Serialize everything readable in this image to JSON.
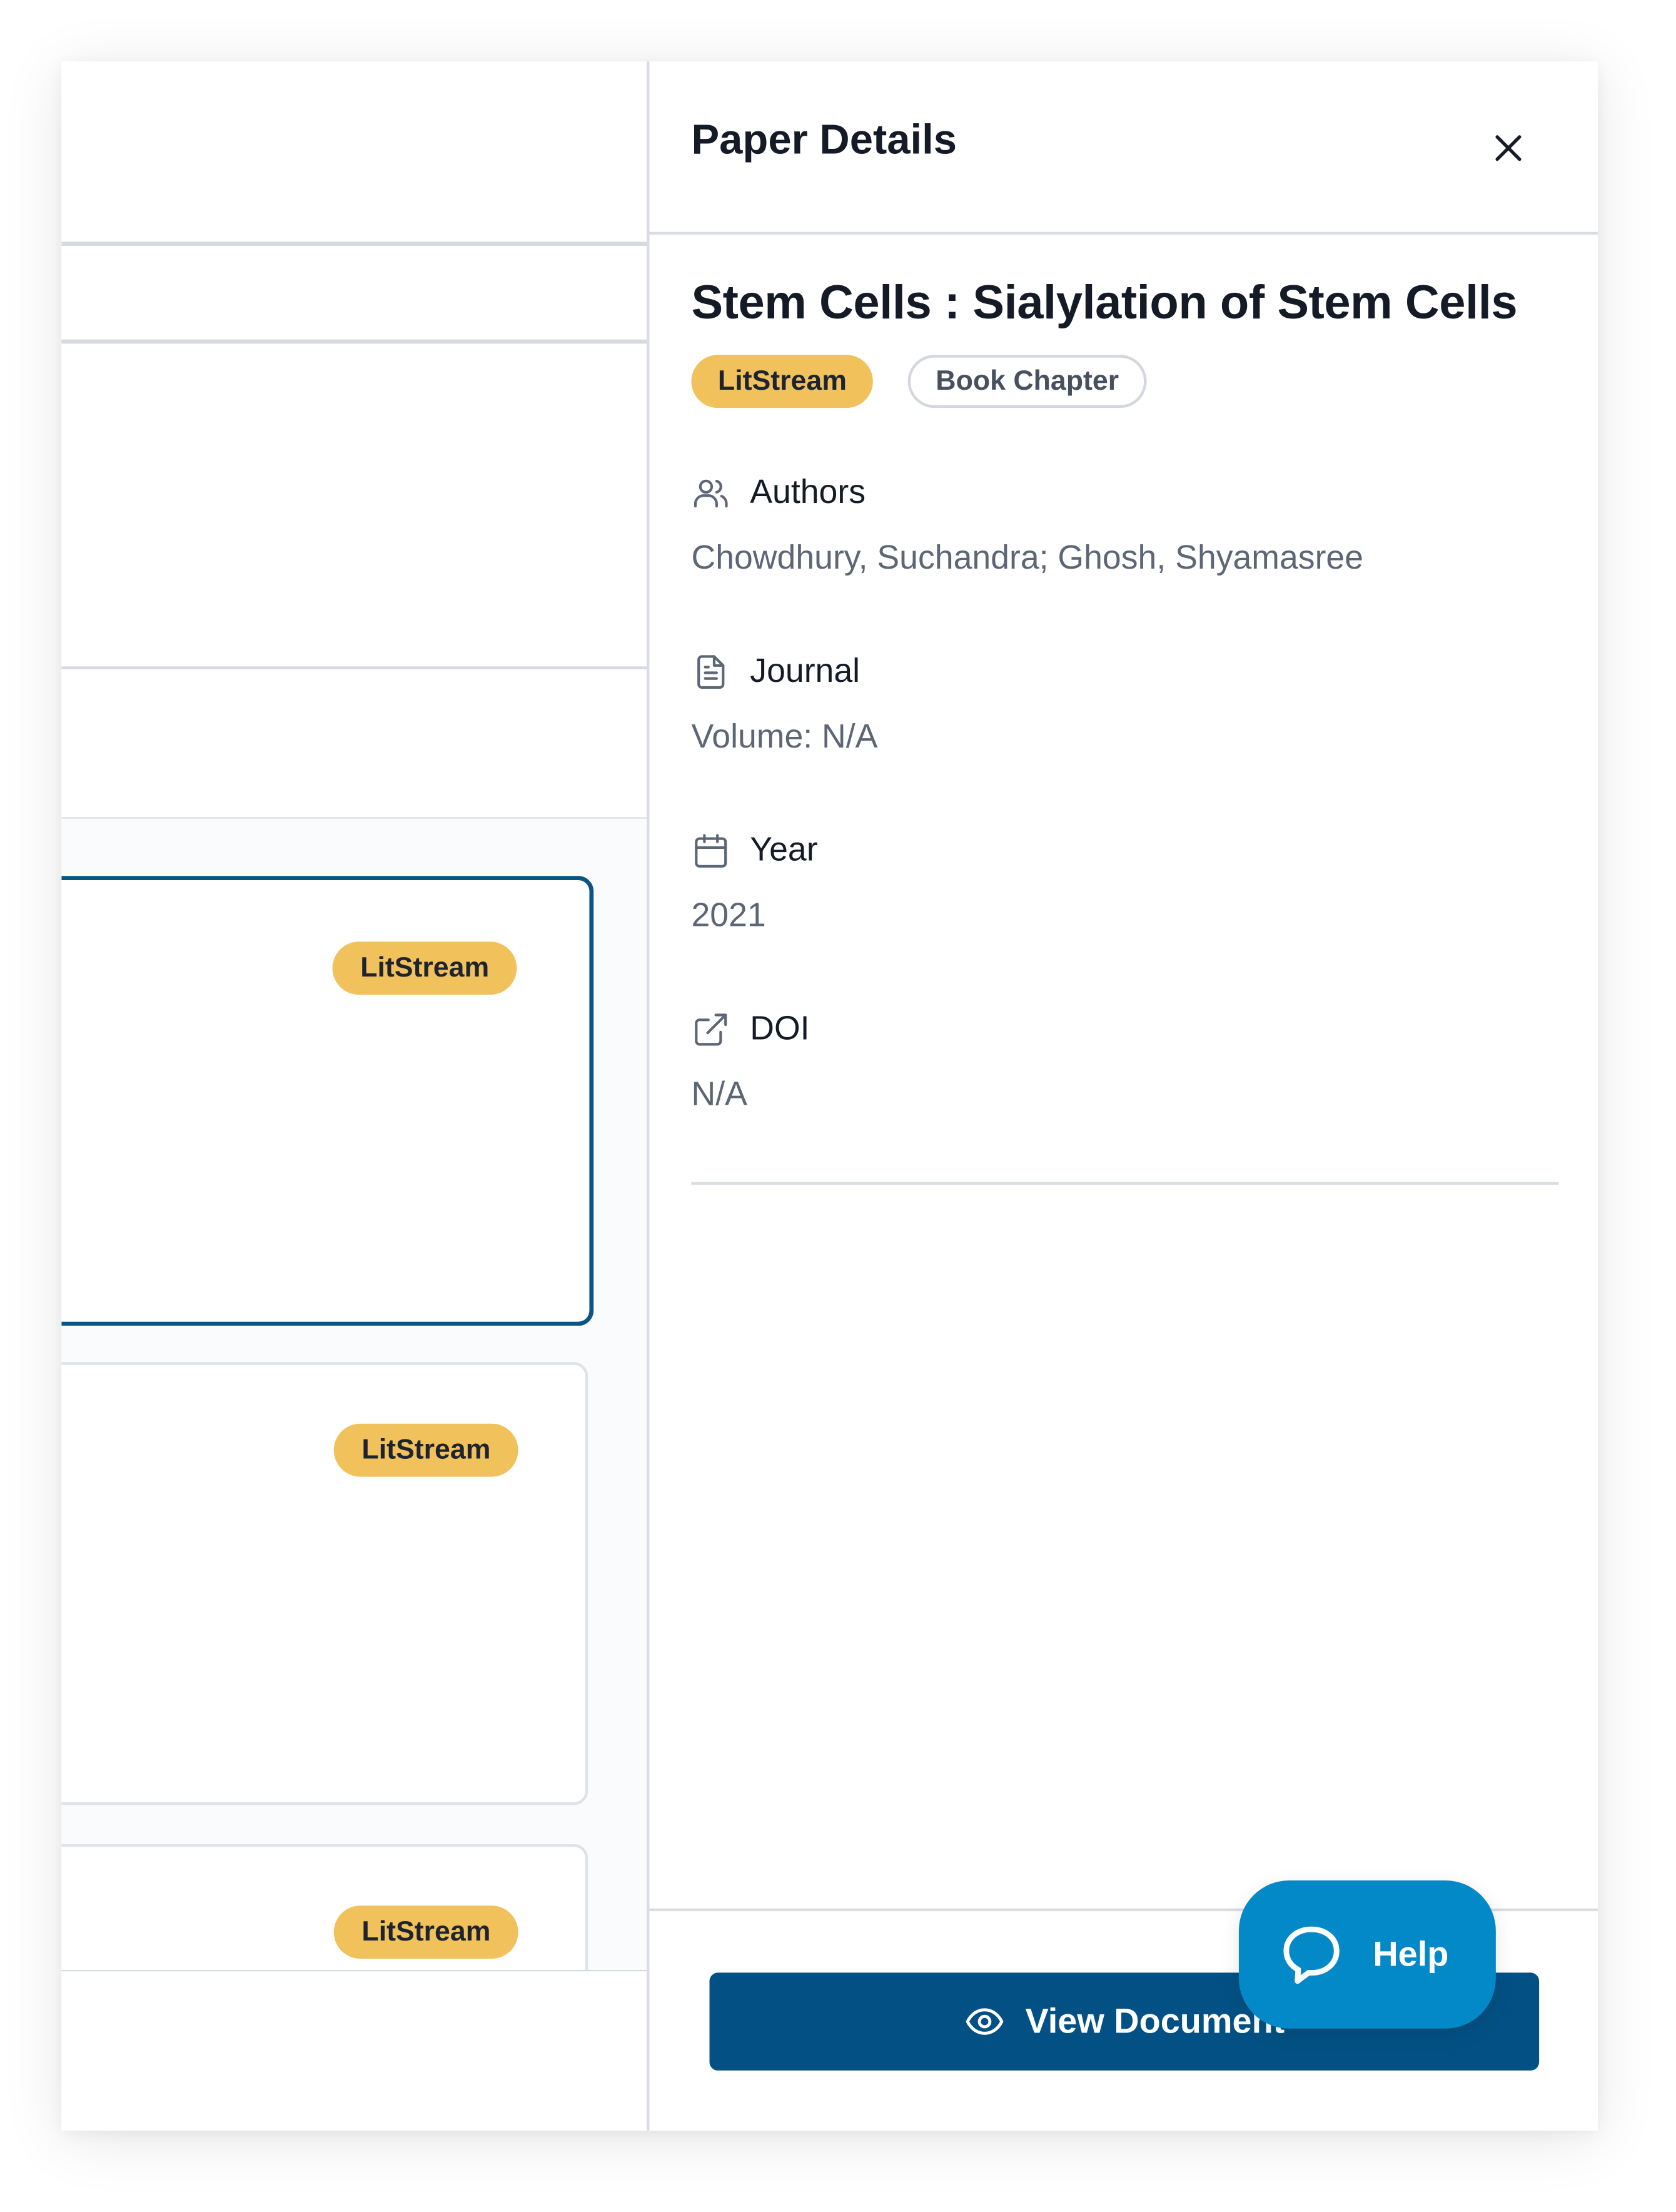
{
  "details": {
    "panel_title": "Paper Details",
    "paper_title": "Stem Cells : Sialylation of Stem Cells",
    "badges": {
      "source": "LitStream",
      "type": "Book Chapter"
    },
    "sections": {
      "authors": {
        "label": "Authors",
        "value": "Chowdhury, Suchandra; Ghosh, Shyamasree",
        "icon": "users-icon"
      },
      "journal": {
        "label": "Journal",
        "value": "Volume: N/A",
        "icon": "document-icon"
      },
      "year": {
        "label": "Year",
        "value": "2021",
        "icon": "calendar-icon"
      },
      "doi": {
        "label": "DOI",
        "value": "N/A",
        "icon": "external-link-icon"
      }
    },
    "view_button_label": "View Document"
  },
  "results": {
    "cards": [
      {
        "badge": "LitStream",
        "selected": true
      },
      {
        "badge": "LitStream",
        "selected": false
      },
      {
        "badge": "LitStream",
        "selected": false
      }
    ]
  },
  "help": {
    "label": "Help",
    "icon": "chat-bubble-icon"
  },
  "colors": {
    "primary": "#035184",
    "badge_yellow": "#f1c15b",
    "help_blue": "#0389c8",
    "selected_border": "#0b5486"
  }
}
